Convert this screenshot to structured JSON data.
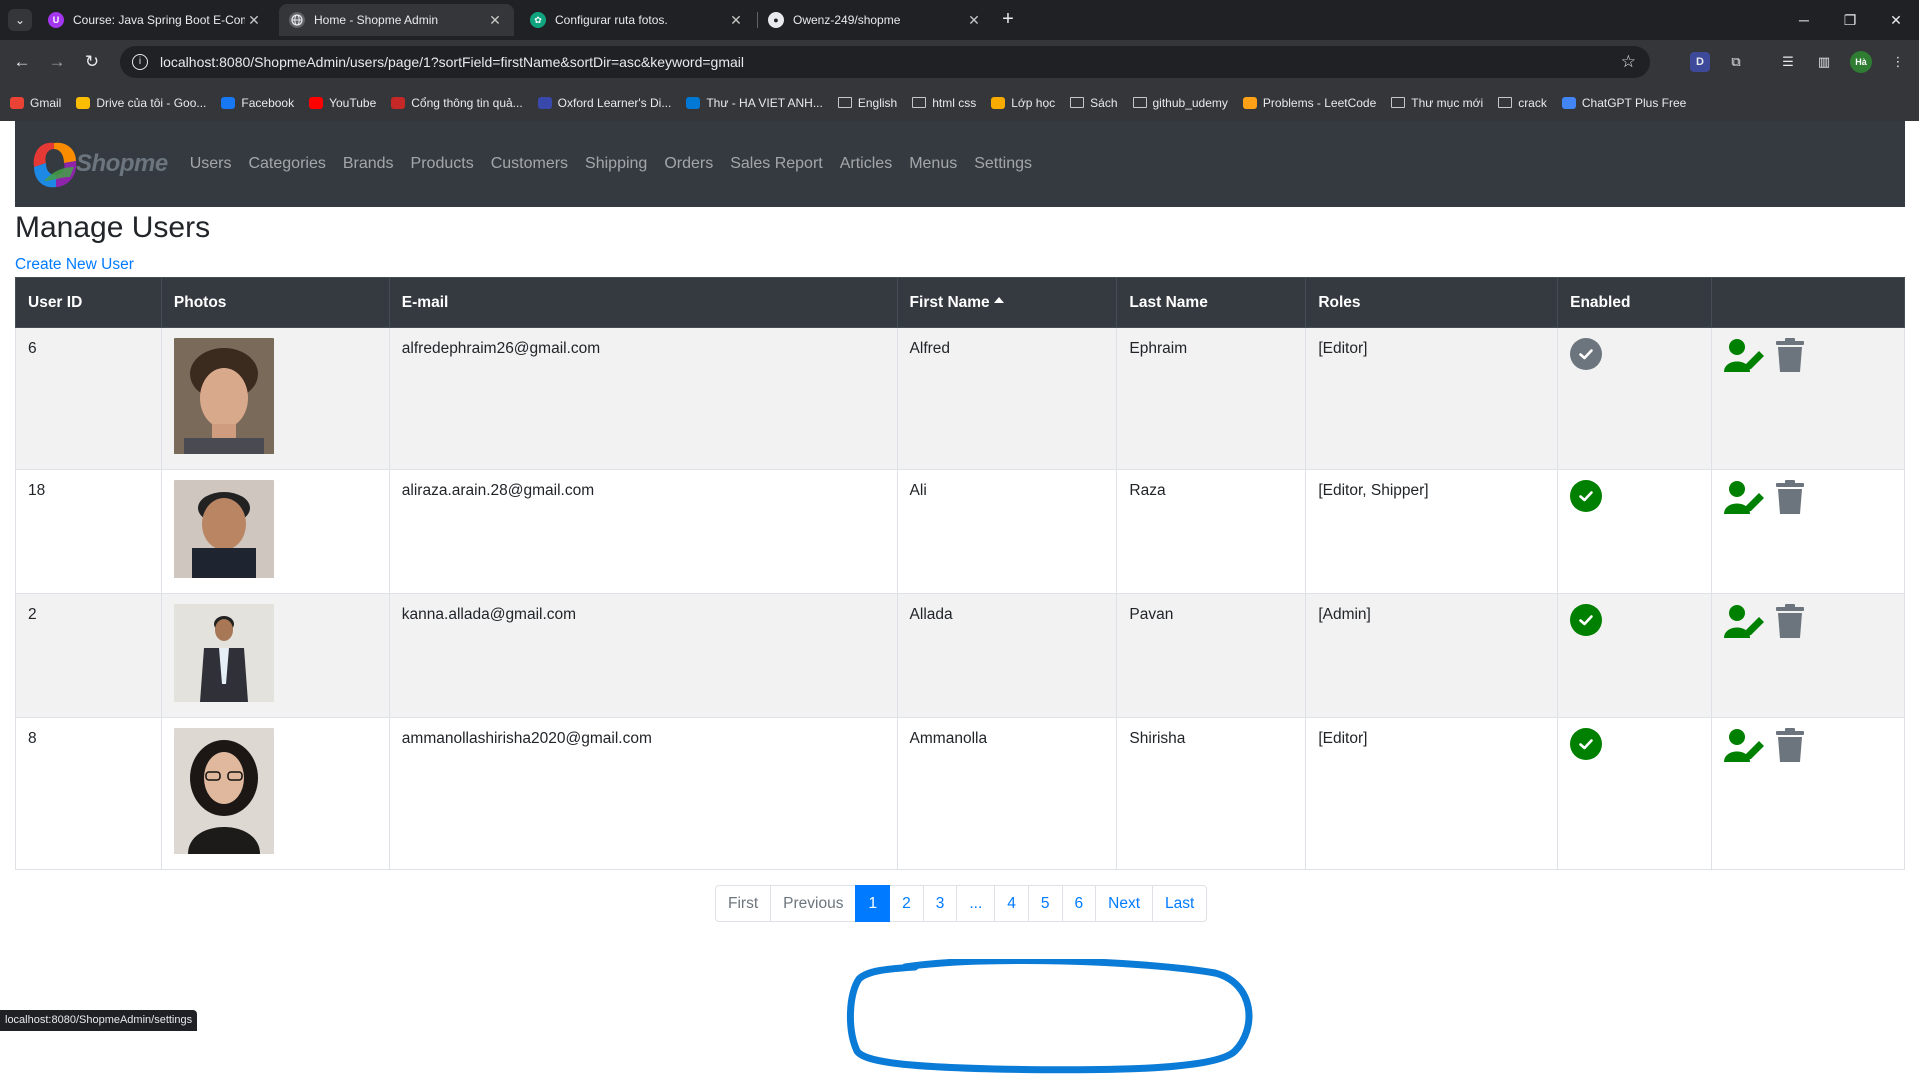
{
  "browser": {
    "tabs": [
      {
        "title": "Course: Java Spring Boot E-Com",
        "favicon": "udemy-icon",
        "active": false
      },
      {
        "title": "Home - Shopme Admin",
        "favicon": "globe-icon",
        "active": true
      },
      {
        "title": "Configurar ruta fotos.",
        "favicon": "chatgpt-icon",
        "active": false
      },
      {
        "title": "Owenz-249/shopme",
        "favicon": "github-icon",
        "active": false
      }
    ],
    "url": "localhost:8080/ShopmeAdmin/users/page/1?sortField=firstName&sortDir=asc&keyword=gmail",
    "profile_initials": "Hà",
    "bookmarks": [
      {
        "label": "Gmail",
        "icon": "gmail-icon",
        "color": "#ea4335"
      },
      {
        "label": "Drive của tôi - Goo...",
        "icon": "drive-icon",
        "color": "#fbbc04"
      },
      {
        "label": "Facebook",
        "icon": "facebook-icon",
        "color": "#1877f2"
      },
      {
        "label": "YouTube",
        "icon": "youtube-icon",
        "color": "#ff0000"
      },
      {
        "label": "Cổng thông tin quả...",
        "icon": "portal-icon",
        "color": "#c62828"
      },
      {
        "label": "Oxford Learner's Di...",
        "icon": "oxford-icon",
        "color": "#3949ab"
      },
      {
        "label": "Thư - HA VIET ANH...",
        "icon": "outlook-icon",
        "color": "#0078d4"
      },
      {
        "label": "English",
        "icon": "folder-icon",
        "color": ""
      },
      {
        "label": "html css",
        "icon": "folder-icon",
        "color": ""
      },
      {
        "label": "Lớp học",
        "icon": "classroom-icon",
        "color": "#f9ab00"
      },
      {
        "label": "Sách",
        "icon": "folder-icon",
        "color": ""
      },
      {
        "label": "github_udemy",
        "icon": "folder-icon",
        "color": ""
      },
      {
        "label": "Problems - LeetCode",
        "icon": "leetcode-icon",
        "color": "#ffa116"
      },
      {
        "label": "Thư mục mới",
        "icon": "folder-icon",
        "color": ""
      },
      {
        "label": "crack",
        "icon": "folder-icon",
        "color": ""
      },
      {
        "label": "ChatGPT Plus Free",
        "icon": "doc-icon",
        "color": "#4285f4"
      }
    ],
    "status_url": "localhost:8080/ShopmeAdmin/settings"
  },
  "navbar": {
    "brand": "Shopme",
    "links": [
      "Users",
      "Categories",
      "Brands",
      "Products",
      "Customers",
      "Shipping",
      "Orders",
      "Sales Report",
      "Articles",
      "Menus",
      "Settings"
    ]
  },
  "main": {
    "title": "Manage Users",
    "create_link": "Create New User"
  },
  "table": {
    "headers": [
      "User ID",
      "Photos",
      "E-mail",
      "First Name",
      "Last Name",
      "Roles",
      "Enabled",
      ""
    ],
    "sorted_column": "First Name",
    "sort_dir": "asc",
    "rows": [
      {
        "id": "6",
        "email": "alfredephraim26@gmail.com",
        "first_name": "Alfred",
        "last_name": "Ephraim",
        "roles": "[Editor]",
        "enabled": false
      },
      {
        "id": "18",
        "email": "aliraza.arain.28@gmail.com",
        "first_name": "Ali",
        "last_name": "Raza",
        "roles": "[Editor, Shipper]",
        "enabled": true
      },
      {
        "id": "2",
        "email": "kanna.allada@gmail.com",
        "first_name": "Allada",
        "last_name": "Pavan",
        "roles": "[Admin]",
        "enabled": true
      },
      {
        "id": "8",
        "email": "ammanollashirisha2020@gmail.com",
        "first_name": "Ammanolla",
        "last_name": "Shirisha",
        "roles": "[Editor]",
        "enabled": true
      }
    ]
  },
  "pagination": {
    "first": "First",
    "previous": "Previous",
    "pages": [
      "1",
      "2",
      "3",
      "...",
      "4",
      "5",
      "6"
    ],
    "active_page": "1",
    "next": "Next",
    "last": "Last"
  },
  "colors": {
    "navbar_bg": "#343a40",
    "link": "#007bff",
    "enabled_green": "#008000",
    "disabled_gray": "#6c757d",
    "annotation_blue": "#0a7bd6"
  }
}
